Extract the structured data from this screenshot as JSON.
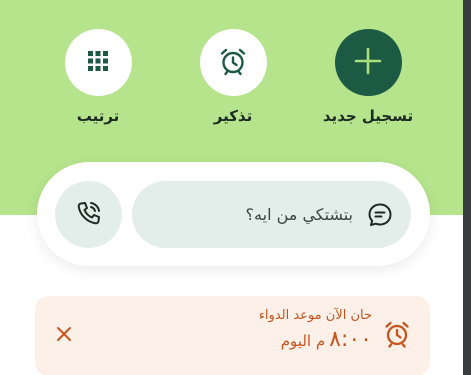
{
  "actions": {
    "new_record": {
      "label": "تسجيل جديد",
      "icon": "plus-icon"
    },
    "reminder": {
      "label": "تذكير",
      "icon": "alarm-clock-icon"
    },
    "arrange": {
      "label": "ترتيب",
      "icon": "grid-icon"
    }
  },
  "search": {
    "placeholder": "بتشتكي من ايه؟",
    "leading_icon": "chat-bubble-icon",
    "call_icon": "phone-call-icon"
  },
  "reminder_card": {
    "title": "حان الآن موعد الدواء",
    "time": "٨:٠٠",
    "time_suffix": "م اليوم",
    "icon": "alarm-clock-icon",
    "close_icon": "close-icon"
  },
  "colors": {
    "header_bg": "#b5e48c",
    "primary_dark": "#1d5a43",
    "soft_field": "#e3eeeb",
    "alert_bg": "#fdf0e8",
    "alert_text": "#c8551e"
  }
}
